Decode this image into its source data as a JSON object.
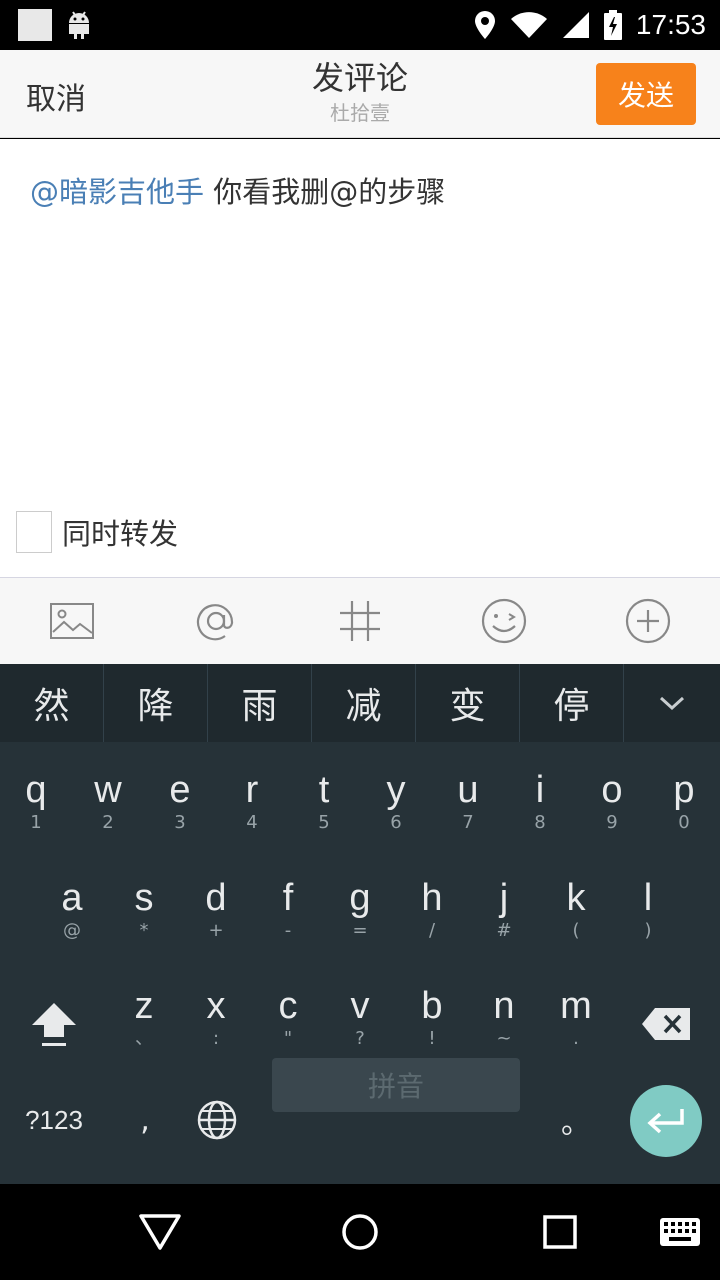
{
  "status_bar": {
    "time": "17:53",
    "icons": [
      "notification-square-icon",
      "android-icon",
      "location-icon",
      "wifi-icon",
      "signal-icon",
      "battery-charging-icon"
    ]
  },
  "header": {
    "cancel_label": "取消",
    "title": "发评论",
    "subtitle": "杜拾壹",
    "send_label": "发送"
  },
  "compose": {
    "mention": "@暗影吉他手",
    "text": " 你看我删@的步骤"
  },
  "repost": {
    "label": "同时转发",
    "checked": false
  },
  "toolbar": {
    "icons": [
      "image-icon",
      "at-icon",
      "hashtag-icon",
      "emoji-icon",
      "add-icon"
    ]
  },
  "keyboard": {
    "candidates": [
      "然",
      "降",
      "雨",
      "减",
      "变",
      "停"
    ],
    "row1": [
      {
        "k": "q",
        "h": "1"
      },
      {
        "k": "w",
        "h": "2"
      },
      {
        "k": "e",
        "h": "3"
      },
      {
        "k": "r",
        "h": "4"
      },
      {
        "k": "t",
        "h": "5"
      },
      {
        "k": "y",
        "h": "6"
      },
      {
        "k": "u",
        "h": "7"
      },
      {
        "k": "i",
        "h": "8"
      },
      {
        "k": "o",
        "h": "9"
      },
      {
        "k": "p",
        "h": "0"
      }
    ],
    "row2": [
      {
        "k": "a",
        "h": "@"
      },
      {
        "k": "s",
        "h": "*"
      },
      {
        "k": "d",
        "h": "+"
      },
      {
        "k": "f",
        "h": "-"
      },
      {
        "k": "g",
        "h": "="
      },
      {
        "k": "h",
        "h": "/"
      },
      {
        "k": "j",
        "h": "#"
      },
      {
        "k": "k",
        "h": "("
      },
      {
        "k": "l",
        "h": ")"
      }
    ],
    "row3": [
      {
        "k": "z",
        "h": "、"
      },
      {
        "k": "x",
        "h": ":"
      },
      {
        "k": "c",
        "h": "\""
      },
      {
        "k": "v",
        "h": "?"
      },
      {
        "k": "b",
        "h": "!"
      },
      {
        "k": "n",
        "h": "~"
      },
      {
        "k": "m",
        "h": "."
      }
    ],
    "symbols_label": "?123",
    "comma_label": ",",
    "space_label": "拼音",
    "period_label": "。"
  },
  "colors": {
    "accent": "#f7821b",
    "mention": "#4a7fb5",
    "keyboard_bg": "#263238",
    "enter": "#80cbc4"
  }
}
